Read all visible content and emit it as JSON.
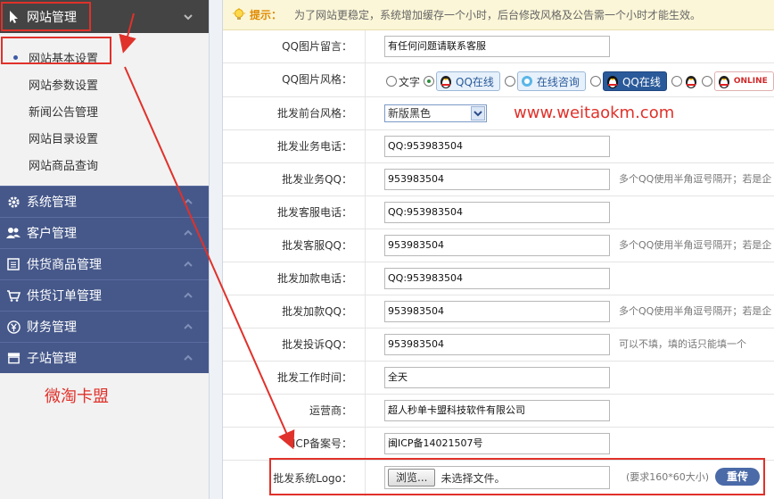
{
  "sidebar": {
    "header": {
      "label": "网站管理",
      "icon": "cursor-icon"
    },
    "sub_items": [
      {
        "label": "网站基本设置",
        "active": true
      },
      {
        "label": "网站参数设置"
      },
      {
        "label": "新闻公告管理"
      },
      {
        "label": "网站目录设置"
      },
      {
        "label": "网站商品查询"
      }
    ],
    "sections": [
      {
        "label": "系统管理",
        "icon": "gear-icon"
      },
      {
        "label": "客户管理",
        "icon": "users-icon"
      },
      {
        "label": "供货商品管理",
        "icon": "list-icon"
      },
      {
        "label": "供货订单管理",
        "icon": "cart-icon"
      },
      {
        "label": "财务管理",
        "icon": "yen-icon"
      },
      {
        "label": "子站管理",
        "icon": "store-icon"
      }
    ]
  },
  "watermark": "微淘卡盟",
  "site_url": "www.weitaokm.com",
  "notice": {
    "label": "提示：",
    "text": "为了网站更稳定，系统增加缓存一个小时，后台修改风格及公告需一个小时才能生效。"
  },
  "form": {
    "qq_message": {
      "label": "QQ图片留言：",
      "value": "有任何问题请联系客服"
    },
    "qq_style": {
      "label": "QQ图片风格：",
      "text_option": "文字",
      "options": [
        "QQ在线",
        "在线咨询",
        "QQ在线",
        "",
        "ONLINE"
      ],
      "selected_index": 1
    },
    "front_style": {
      "label": "批发前台风格：",
      "value": "新版黑色"
    },
    "business_phone": {
      "label": "批发业务电话：",
      "value": "QQ:953983504"
    },
    "business_qq": {
      "label": "批发业务QQ：",
      "value": "953983504",
      "hint": "多个QQ使用半角逗号隔开；若是企"
    },
    "service_phone": {
      "label": "批发客服电话：",
      "value": "QQ:953983504"
    },
    "service_qq": {
      "label": "批发客服QQ：",
      "value": "953983504",
      "hint": "多个QQ使用半角逗号隔开；若是企"
    },
    "topup_phone": {
      "label": "批发加款电话：",
      "value": "QQ:953983504"
    },
    "topup_qq": {
      "label": "批发加款QQ：",
      "value": "953983504",
      "hint": "多个QQ使用半角逗号隔开；若是企"
    },
    "complaint_qq": {
      "label": "批发投诉QQ：",
      "value": "953983504",
      "hint": "可以不填，填的话只能填一个"
    },
    "work_time": {
      "label": "批发工作时间：",
      "value": "全天"
    },
    "operator": {
      "label": "运营商：",
      "value": "超人秒单卡盟科技软件有限公司"
    },
    "icp": {
      "label": "ICP备案号：",
      "value": "闽ICP备14021507号"
    },
    "logo": {
      "label": "批发系统Logo：",
      "browse_label": "浏览...",
      "file_status": "未选择文件。",
      "hint": "(要求160*60大小)",
      "upload_label": "重传"
    }
  },
  "colors": {
    "sidebar_blue": "#46588a",
    "sidebar_dark": "#444444",
    "annotation_red": "#e0312a",
    "notice_bg": "#fbf6d7"
  }
}
